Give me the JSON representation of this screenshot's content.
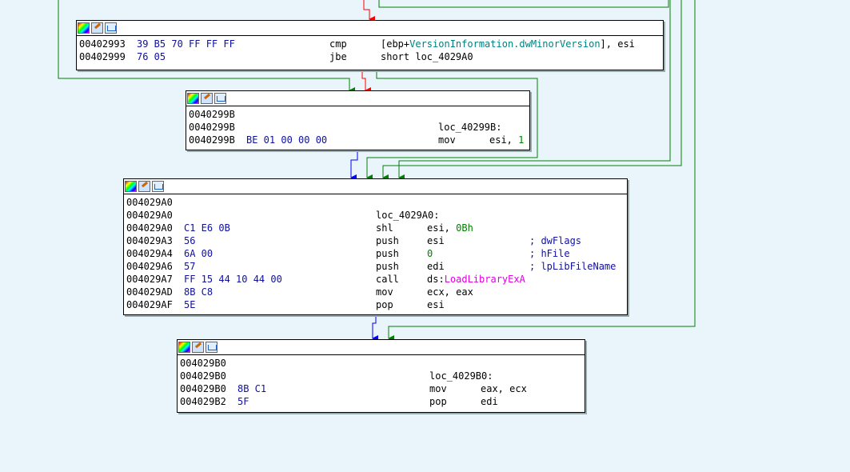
{
  "blocks": [
    {
      "id": "blk-402993",
      "lines": [
        {
          "addr": "00402993",
          "bytes": "39 B5 70 FF FF FF",
          "mnemonic": "cmp",
          "op_pre": "[ebp+",
          "op_field": "VersionInformation.dwMinorVersion",
          "op_post": "], esi"
        },
        {
          "addr": "00402999",
          "bytes": "76 05",
          "mnemonic": "jbe",
          "op_pre": "short loc_4029A0"
        }
      ]
    },
    {
      "id": "blk-40299B",
      "lines": [
        {
          "addr": "0040299B"
        },
        {
          "addr": "0040299B",
          "label": "loc_40299B:"
        },
        {
          "addr": "0040299B",
          "bytes": "BE 01 00 00 00",
          "mnemonic": "mov",
          "op_pre": "esi, ",
          "op_imm": "1"
        }
      ]
    },
    {
      "id": "blk-4029A0",
      "lines": [
        {
          "addr": "004029A0"
        },
        {
          "addr": "004029A0",
          "label": "loc_4029A0:"
        },
        {
          "addr": "004029A0",
          "bytes": "C1 E6 0B",
          "mnemonic": "shl",
          "op_pre": "esi, ",
          "op_imm": "0Bh"
        },
        {
          "addr": "004029A3",
          "bytes": "56",
          "mnemonic": "push",
          "op_pre": "esi",
          "comment": "; dwFlags"
        },
        {
          "addr": "004029A4",
          "bytes": "6A 00",
          "mnemonic": "push",
          "op_imm": "0",
          "comment": "; hFile"
        },
        {
          "addr": "004029A6",
          "bytes": "57",
          "mnemonic": "push",
          "op_pre": "edi",
          "comment": "; lpLibFileName"
        },
        {
          "addr": "004029A7",
          "bytes": "FF 15 44 10 44 00",
          "mnemonic": "call",
          "op_pre": "ds:",
          "op_import": "LoadLibraryExA"
        },
        {
          "addr": "004029AD",
          "bytes": "8B C8",
          "mnemonic": "mov",
          "op_pre": "ecx, eax"
        },
        {
          "addr": "004029AF",
          "bytes": "5E",
          "mnemonic": "pop",
          "op_pre": "esi"
        }
      ]
    },
    {
      "id": "blk-4029B0",
      "lines": [
        {
          "addr": "004029B0"
        },
        {
          "addr": "004029B0",
          "label": "loc_4029B0:"
        },
        {
          "addr": "004029B0",
          "bytes": "8B C1",
          "mnemonic": "mov",
          "op_pre": "eax, ecx"
        },
        {
          "addr": "004029B2",
          "bytes": "5F",
          "mnemonic": "pop",
          "op_pre": "edi"
        }
      ]
    }
  ],
  "header_icons": [
    "color-palette-icon",
    "edit-node-icon",
    "graph-overview-icon"
  ],
  "colors": {
    "background": "#eaf5fb",
    "edge_true": "#008000",
    "edge_false": "#ff0000",
    "edge_uncond": "#0000ff",
    "bytes": "#1010a0",
    "immediate": "#008000",
    "import": "#e000e0",
    "struct_field": "#008080"
  }
}
